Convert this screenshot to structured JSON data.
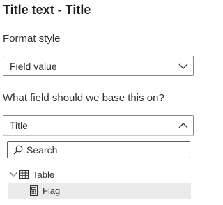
{
  "header": {
    "title": "Title text - Title"
  },
  "format_style": {
    "label": "Format style",
    "value": "Field value"
  },
  "base_field": {
    "label": "What field should we base this on?",
    "value": "Title"
  },
  "field_picker": {
    "search_placeholder": "Search",
    "tree": [
      {
        "label": "Table",
        "icon": "table-icon",
        "expanded": true
      },
      {
        "label": "Flag",
        "icon": "calculator-icon",
        "selected": true
      }
    ]
  },
  "colors": {
    "border": "#8a8886",
    "selected_bg": "#edebe9",
    "text": "#323130"
  }
}
